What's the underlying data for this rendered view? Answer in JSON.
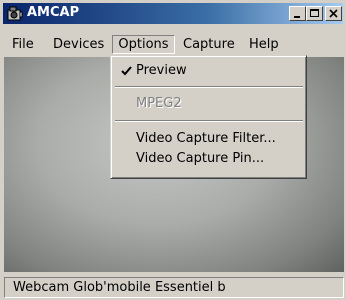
{
  "window": {
    "title": "AMCAP",
    "buttons": {
      "minimize": "_",
      "maximize": "□",
      "close": "×"
    }
  },
  "menubar": {
    "items": [
      "File",
      "Devices",
      "Options",
      "Capture",
      "Help"
    ],
    "open_menu": "Options"
  },
  "options_menu": {
    "items": [
      {
        "label": "Preview",
        "checked": true,
        "enabled": true
      },
      {
        "label": "MPEG2",
        "checked": false,
        "enabled": false
      },
      {
        "label": "Video Capture Filter...",
        "checked": false,
        "enabled": true
      },
      {
        "label": "Video Capture Pin...",
        "checked": false,
        "enabled": true
      }
    ]
  },
  "statusbar": {
    "text": "Webcam Glob'mobile Essentiel b"
  },
  "colors": {
    "titlebar_start": "#0a246a",
    "titlebar_end": "#a6caf0",
    "face": "#d4d0c8",
    "disabled_text": "#808080"
  },
  "icons": {
    "app": "camera-app-icon",
    "checked": "checkmark-icon"
  }
}
